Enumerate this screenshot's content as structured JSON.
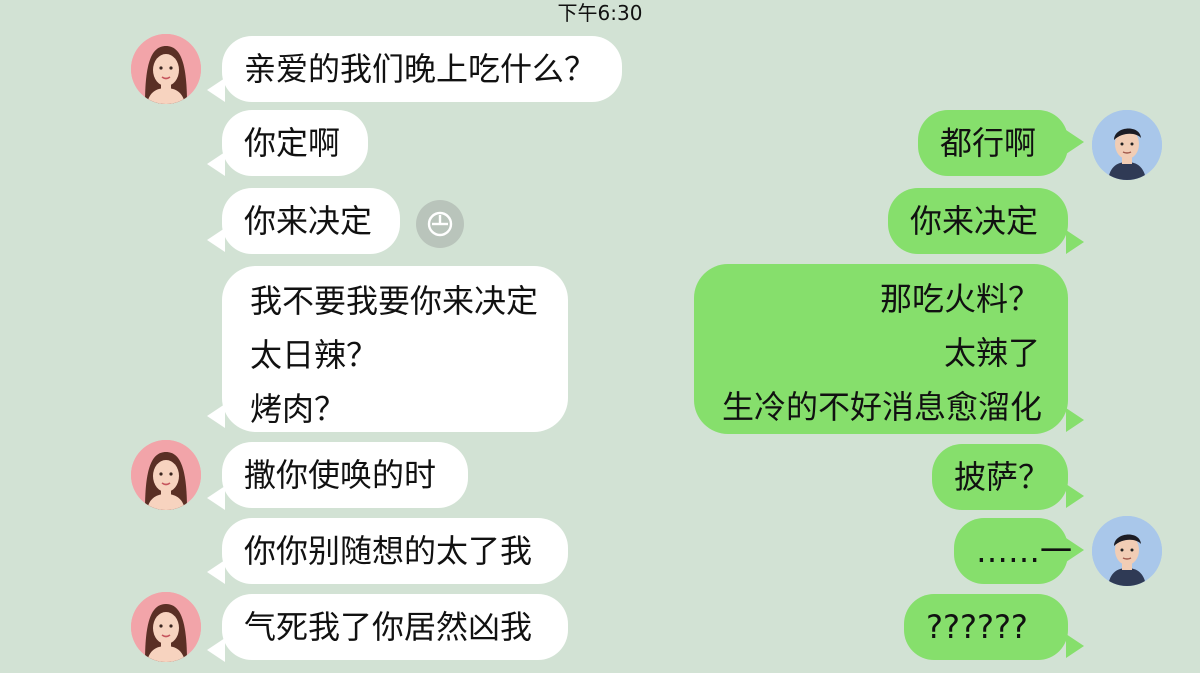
{
  "status": {
    "time": "下午6:30"
  },
  "colors": {
    "background": "#d2e2d4",
    "incoming": "#ffffff",
    "outgoing": "#86df6c"
  },
  "left_messages": [
    {
      "text": "亲爱的我们晚上吃什么？"
    },
    {
      "text": "你定啊"
    },
    {
      "text": "你来决定"
    },
    {
      "lines": [
        "我不要我要你来决定",
        "太日辣？",
        "烤肉？"
      ]
    },
    {
      "text": "撒你使唤的时"
    },
    {
      "text": "你你别随想的太了我"
    },
    {
      "text": "气死我了你居然凶我"
    }
  ],
  "right_messages": [
    {
      "text": "都行啊"
    },
    {
      "text": "你来决定"
    },
    {
      "lines": [
        "那吃火料？",
        "太辣了",
        "生冷的不好消息愈溜化"
      ]
    },
    {
      "text": "披萨？"
    },
    {
      "text": "……一"
    },
    {
      "text": "??????"
    }
  ],
  "icons": {
    "clock": "clock-icon",
    "female_avatar": "female-avatar-icon",
    "male_avatar": "male-avatar-icon"
  }
}
